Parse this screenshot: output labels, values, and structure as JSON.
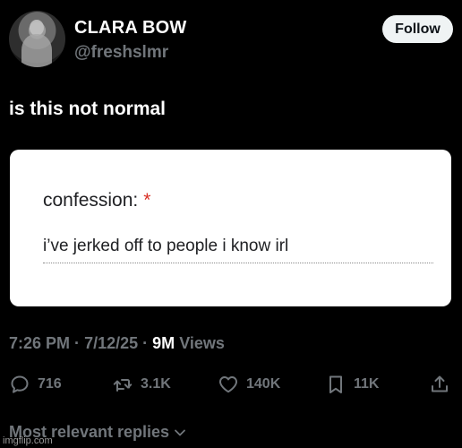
{
  "user": {
    "name": "CLARA BOW",
    "handle": "@freshslmr",
    "follow_label": "Follow"
  },
  "tweet": {
    "text": "is this not normal"
  },
  "card": {
    "label": "confession:",
    "required_marker": "*",
    "answer": "i’ve jerked off to people i know irl"
  },
  "meta": {
    "time": "7:26 PM",
    "separator": "·",
    "date": "7/12/25",
    "views_count": "9M",
    "views_label": "Views"
  },
  "actions": {
    "replies": "716",
    "reposts": "3.1K",
    "likes": "140K",
    "bookmarks": "11K"
  },
  "replies_sort": {
    "label": "Most relevant replies"
  },
  "watermark": "imgflip.com"
}
